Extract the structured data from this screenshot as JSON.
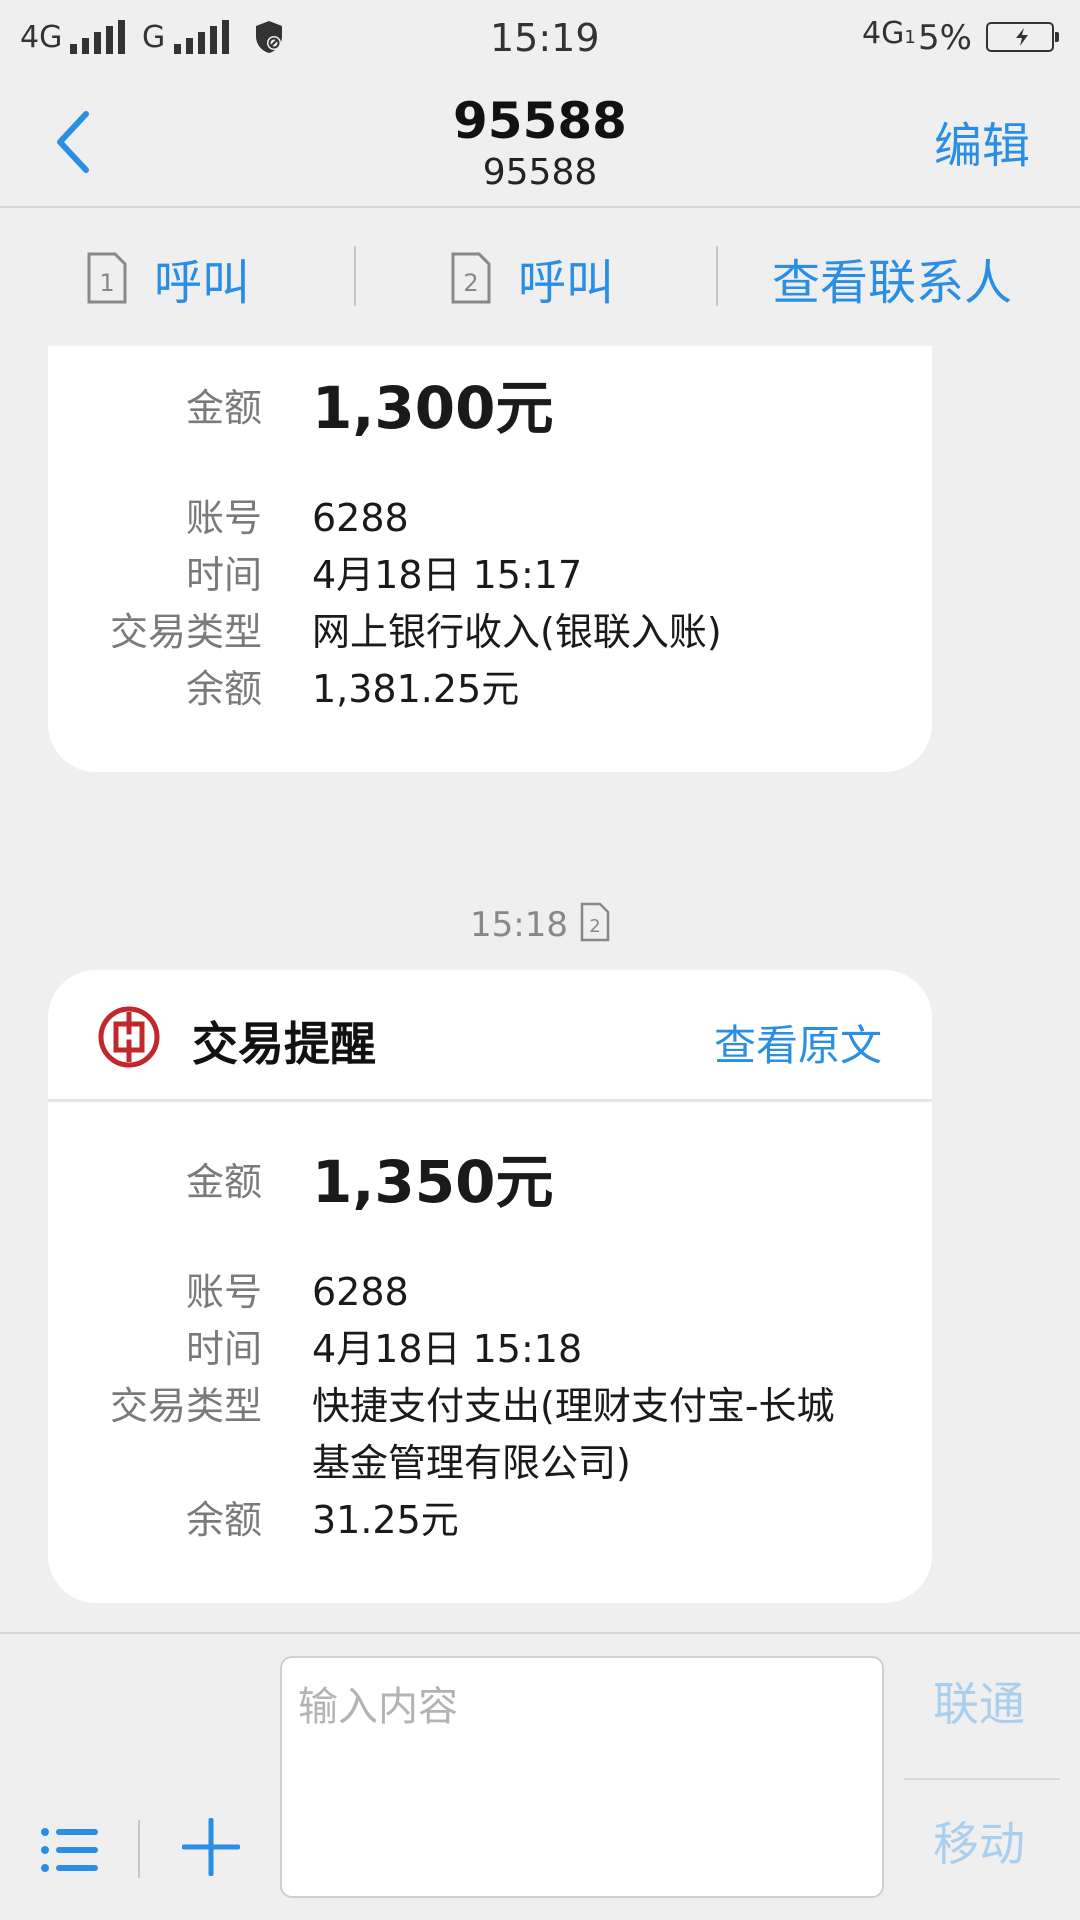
{
  "status_bar": {
    "net1": "4G",
    "net2": "G",
    "time": "15:19",
    "net3": "4G",
    "net3_sub": "1",
    "battery": "5%"
  },
  "header": {
    "title": "95588",
    "subtitle": "95588",
    "edit": "编辑"
  },
  "actions": {
    "call1": "呼叫",
    "call2": "呼叫",
    "view_contact": "查看联系人"
  },
  "sim_labels": {
    "sim1": "1",
    "sim2": "2"
  },
  "messages": [
    {
      "amount_label": "金额",
      "amount": "1,300元",
      "account_label": "账号",
      "account": "6288",
      "time_label": "时间",
      "time": "4月18日 15:17",
      "type_label": "交易类型",
      "type": "网上银行收入(银联入账)",
      "balance_label": "余额",
      "balance": "1,381.25元"
    },
    {
      "timestamp": "15:18",
      "title": "交易提醒",
      "view_original": "查看原文",
      "amount_label": "金额",
      "amount": "1,350元",
      "account_label": "账号",
      "account": "6288",
      "time_label": "时间",
      "time": "4月18日 15:18",
      "type_label": "交易类型",
      "type": "快捷支付支出(理财支付宝-长城基金管理有限公司)",
      "balance_label": "余额",
      "balance": "31.25元"
    }
  ],
  "composer": {
    "placeholder": "输入内容",
    "send_unicom": "联通",
    "send_mobile": "移动"
  },
  "colors": {
    "accent": "#2a8ee4",
    "bank_red": "#c0282d",
    "disabled_send": "#a9cfee"
  }
}
